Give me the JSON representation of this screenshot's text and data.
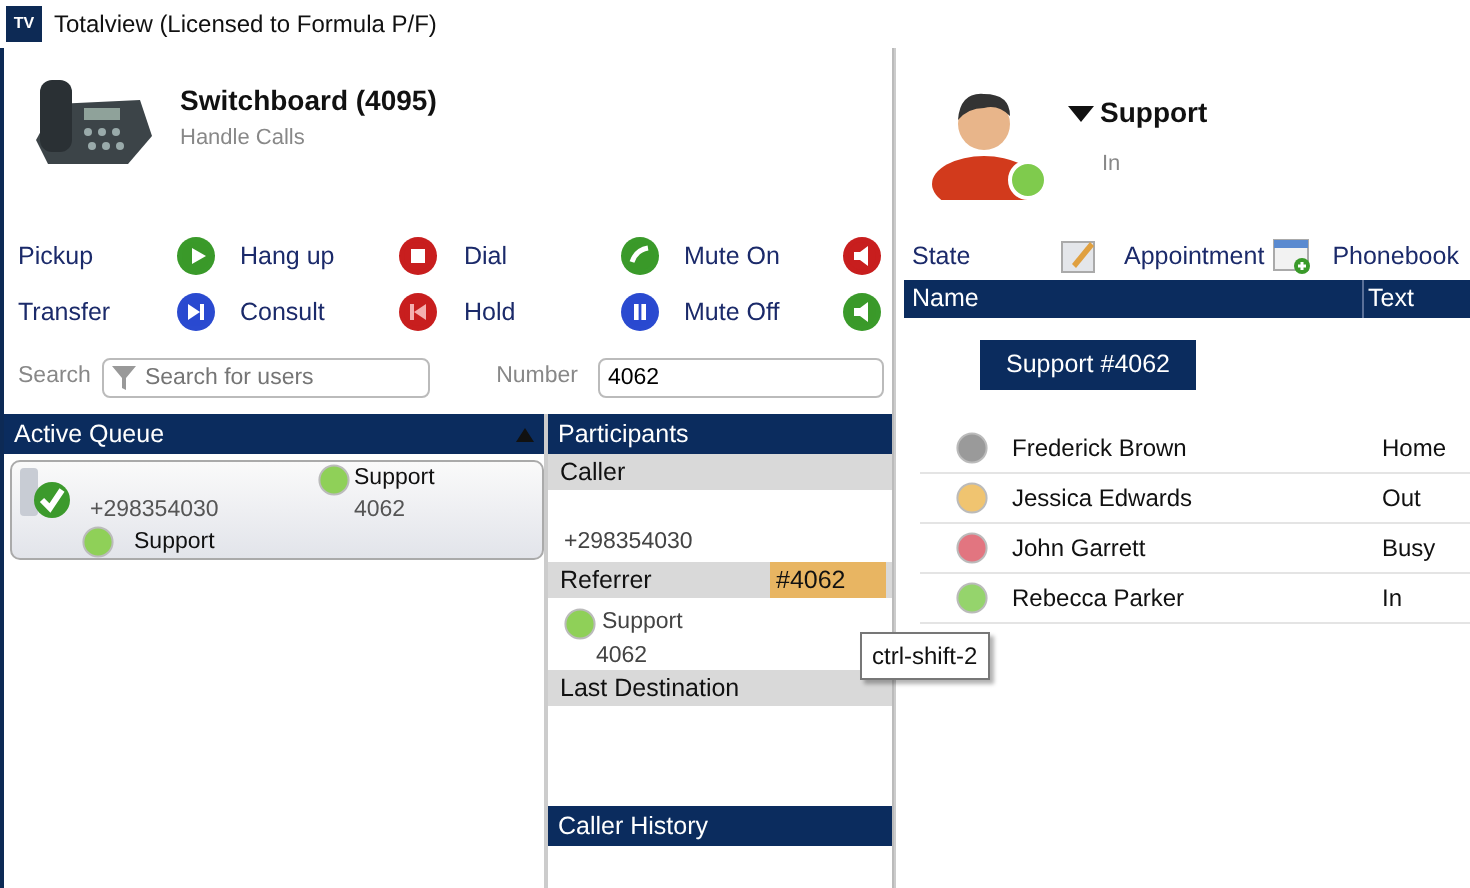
{
  "window": {
    "logo": "TV",
    "title": "Totalview  (Licensed to Formula P/F)"
  },
  "switchboard": {
    "name": "Switchboard (4095)",
    "subtitle": "Handle Calls"
  },
  "actions": [
    {
      "label": "Pickup",
      "kind": "play"
    },
    {
      "label": "Hang up",
      "kind": "stop"
    },
    {
      "label": "Dial",
      "kind": "phone"
    },
    {
      "label": "Mute On",
      "kind": "mute"
    },
    {
      "label": "Transfer",
      "kind": "next"
    },
    {
      "label": "Consult",
      "kind": "back"
    },
    {
      "label": "Hold",
      "kind": "pause"
    },
    {
      "label": "Mute Off",
      "kind": "speaker"
    }
  ],
  "search": {
    "label": "Search",
    "placeholder": "Search for users"
  },
  "number": {
    "label": "Number",
    "value": "4062"
  },
  "active_queue": {
    "title": "Active Queue",
    "items": [
      {
        "number": "+298354030",
        "destination": "Support",
        "destination_number": "4062",
        "agent": "Support"
      }
    ]
  },
  "participants": {
    "title": "Participants",
    "sections": [
      {
        "title": "Caller",
        "kind": "number",
        "entries": [
          "+298354030"
        ]
      },
      {
        "title": "Referrer",
        "kind": "contact",
        "tag": "#4062",
        "entries": [
          "Support",
          "4062"
        ]
      },
      {
        "title": "Last Destination",
        "kind": "empty"
      }
    ]
  },
  "caller_history": {
    "title": "Caller History"
  },
  "tooltip": {
    "text": "ctrl-shift-2"
  },
  "profile": {
    "name": "Support",
    "status": "In"
  },
  "toolbar": [
    {
      "label": "State",
      "kind": "edit"
    },
    {
      "label": "Appointment",
      "kind": "calendar"
    },
    {
      "label": "Phonebook",
      "kind": "none"
    }
  ],
  "table": {
    "columns": [
      "Name",
      "Text"
    ],
    "group": "Support #4062",
    "rows": [
      {
        "name": "Frederick Brown",
        "text": "Home",
        "color": "#9a9a9a"
      },
      {
        "name": "Jessica Edwards",
        "text": "Out",
        "color": "#f0c470"
      },
      {
        "name": "John Garrett",
        "text": "Busy",
        "color": "#e27580"
      },
      {
        "name": "Rebecca Parker",
        "text": "In",
        "color": "#95d46c"
      }
    ]
  }
}
